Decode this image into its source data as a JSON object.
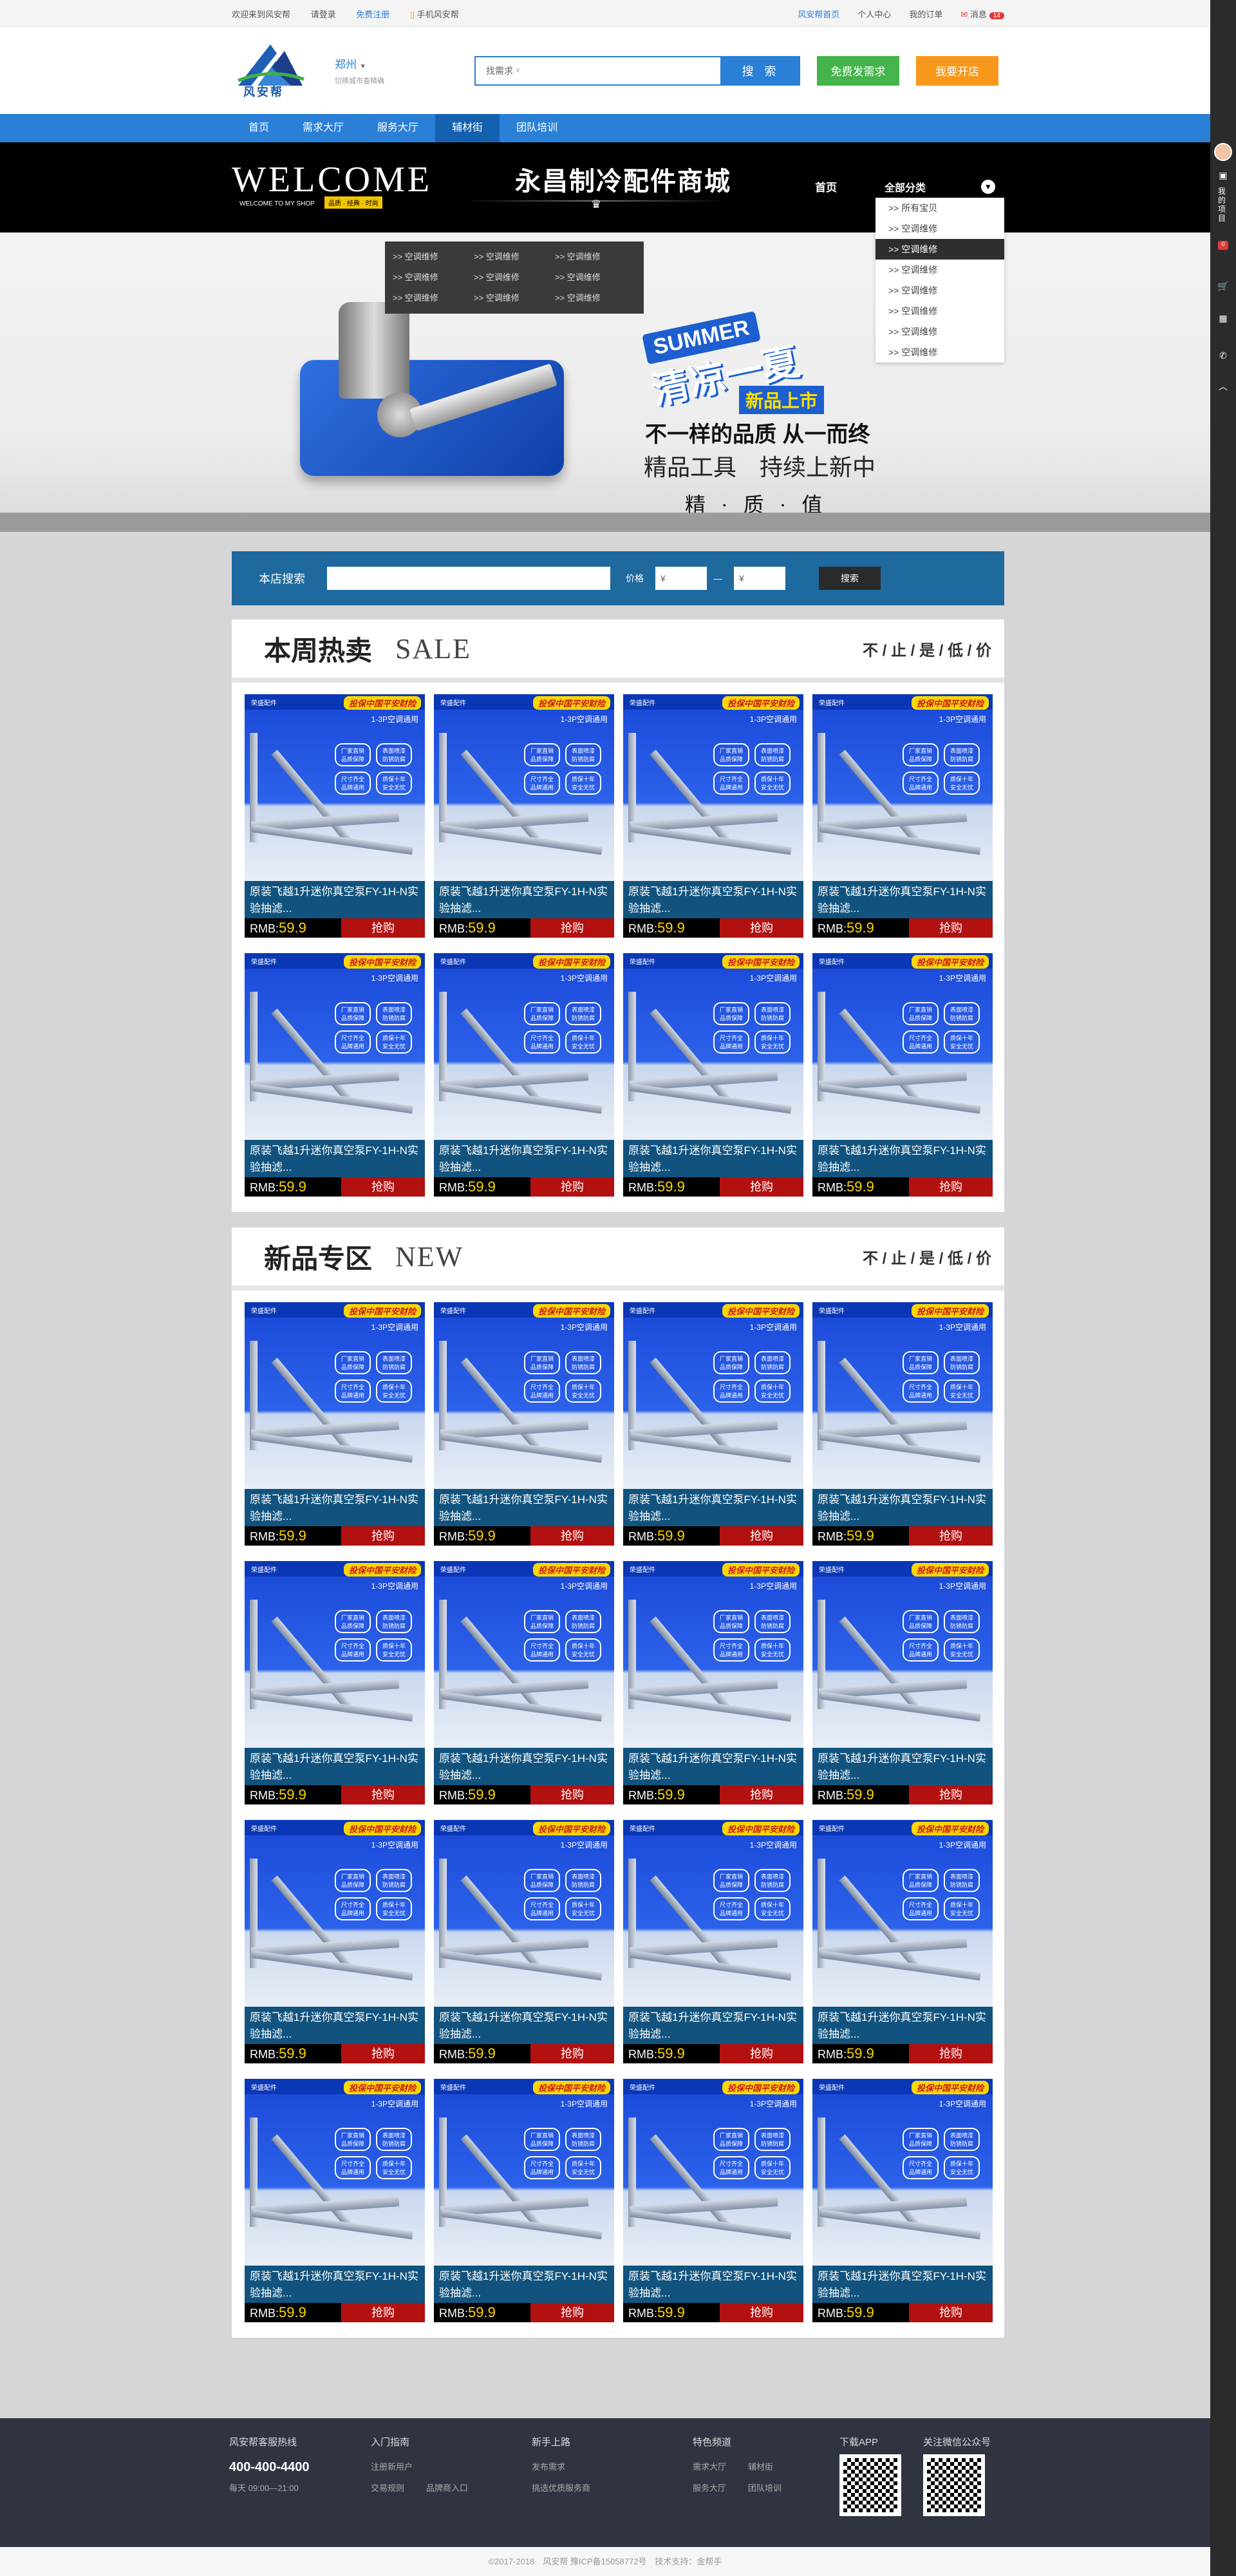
{
  "topbar": {
    "welcome": "欢迎来到风安帮",
    "login": "请登录",
    "register": "免费注册",
    "mobile": "手机风安帮",
    "home": "风安帮首页",
    "center": "个人中心",
    "orders": "我的订单",
    "messages": "消息",
    "message_count": "14"
  },
  "header": {
    "logo_text": "风安帮",
    "city": "郑州",
    "city_sub": "切换城市查精确",
    "search_placeholder": "找需求",
    "search_button": "搜 索",
    "publish_button": "免费发需求",
    "open_store_button": "我要开店"
  },
  "nav": {
    "items": [
      "首页",
      "需求大厅",
      "服务大厅",
      "辅材街",
      "团队培训"
    ],
    "active_index": 3
  },
  "shop": {
    "welcome": "WELCOME",
    "welcome_sub": "WELCOME TO MY SHOP",
    "welcome_tag": "品质 · 经典 · 时尚",
    "title": "永昌制冷配件商城",
    "home": "首页",
    "category_head": "全部分类",
    "categories": [
      ">> 所有宝贝",
      ">> 空调维修",
      ">> 空调维修",
      ">> 空调维修",
      ">> 空调维修",
      ">> 空调维修",
      ">> 空调维修",
      ">> 空调维修"
    ],
    "active_category": 2,
    "submenu": [
      ">> 空调维修",
      ">> 空调维修",
      ">> 空调维修",
      ">> 空调维修",
      ">> 空调维修",
      ">> 空调维修",
      ">> 空调维修",
      ">> 空调维修",
      ">> 空调维修"
    ]
  },
  "hero": {
    "summer": "SUMMER",
    "summer_cn": "清凉一夏",
    "new": "新品上市",
    "line1": "不一样的品质 从一而终",
    "line2": "精品工具　持续上新中",
    "line3": "精 · 质 · 值"
  },
  "store_search": {
    "label": "本店搜索",
    "price": "价格",
    "yuan1": "¥",
    "yuan2": "¥",
    "dash": "—",
    "button": "搜索"
  },
  "sections": [
    {
      "cn": "本周热卖",
      "en": "SALE",
      "slogan": "不 / 止 / 是 / 低 / 价"
    },
    {
      "cn": "新品专区",
      "en": "NEW",
      "slogan": "不 / 止 / 是 / 低 / 价"
    }
  ],
  "product": {
    "brand": "荣盛配件",
    "slogan": "投保中国平安财险",
    "use": "1-3P空调通用",
    "badges": [
      "厂家直销\n品质保障",
      "表面喷漆\n防锈防腐",
      "尺寸齐全\n品牌通用",
      "质保十年\n安全无忧"
    ],
    "name": "原装飞越1升迷你真空泵FY-1H-N实验抽滤...",
    "price_label": "RMB:",
    "price": "59.9",
    "buy": "抢购"
  },
  "footer": {
    "hotline_title": "风安帮客服热线",
    "hotline": "400-400-4400",
    "hours": "每天 09:00—21:00",
    "guide_title": "入门指南",
    "guide_links": [
      "注册新用户",
      "交易规则",
      "品牌商入口"
    ],
    "newbie_title": "新手上路",
    "newbie_links": [
      "发布需求",
      "挑选优质服务商"
    ],
    "feature_title": "特色频道",
    "feature_links": [
      "需求大厅",
      "辅材街",
      "服务大厅",
      "团队培训"
    ],
    "app_title": "下载APP",
    "wechat_title": "关注微信公众号",
    "copyright": "©2017-2018　风安帮 豫ICP备15058772号　技术支持：金帮手"
  },
  "sidebar": {
    "project_text": "我的项目",
    "count": "0"
  }
}
